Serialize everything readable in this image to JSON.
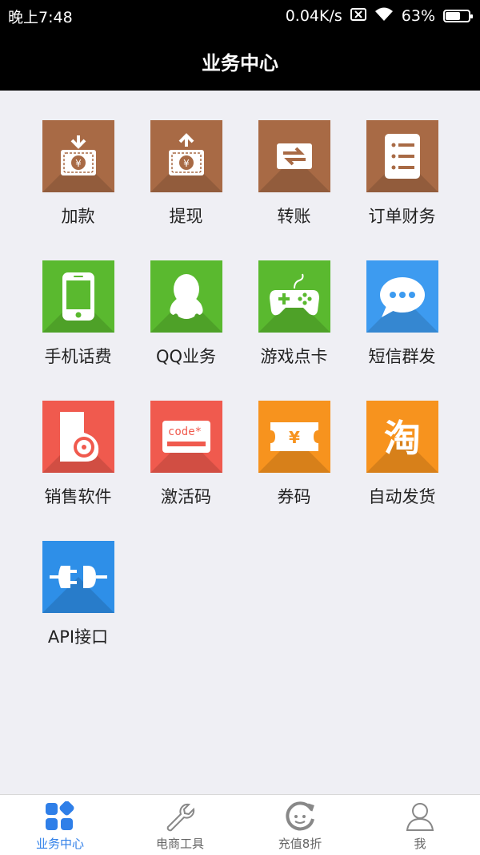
{
  "status_bar": {
    "time": "晚上7:48",
    "network_speed": "0.04K/s",
    "battery": "63%",
    "battery_level": 0.63
  },
  "header": {
    "title": "业务中心"
  },
  "tiles": [
    {
      "label": "加款",
      "icon": "wallet-deposit-icon",
      "color": "#a86a45"
    },
    {
      "label": "提现",
      "icon": "wallet-withdraw-icon",
      "color": "#a86a45"
    },
    {
      "label": "转账",
      "icon": "transfer-icon",
      "color": "#a86a45"
    },
    {
      "label": "订单财务",
      "icon": "order-list-icon",
      "color": "#a86a45"
    },
    {
      "label": "手机话费",
      "icon": "phone-icon",
      "color": "#5ab92f"
    },
    {
      "label": "QQ业务",
      "icon": "qq-penguin-icon",
      "color": "#5ab92f"
    },
    {
      "label": "游戏点卡",
      "icon": "gamepad-icon",
      "color": "#5ab92f"
    },
    {
      "label": "短信群发",
      "icon": "sms-bubble-icon",
      "color": "#2e8fe8"
    },
    {
      "label": "销售软件",
      "icon": "software-disc-icon",
      "color": "#f05a4e"
    },
    {
      "label": "激活码",
      "icon": "activation-code-icon",
      "color": "#f05a4e"
    },
    {
      "label": "券码",
      "icon": "coupon-icon",
      "color": "#f7931e"
    },
    {
      "label": "自动发货",
      "icon": "taobao-icon",
      "color": "#f7931e"
    },
    {
      "label": "API接口",
      "icon": "api-plug-icon",
      "color": "#2e8fe8"
    }
  ],
  "bottom_nav": [
    {
      "label": "业务中心",
      "icon": "grid-apps-icon",
      "active": true
    },
    {
      "label": "电商工具",
      "icon": "wrench-icon",
      "active": false
    },
    {
      "label": "充值8折",
      "icon": "smiley-face-icon",
      "active": false
    },
    {
      "label": "我",
      "icon": "person-icon",
      "active": false
    }
  ],
  "colors": {
    "accent": "#2f7fe8",
    "header_bg": "#000000",
    "page_bg": "#efeff4"
  }
}
